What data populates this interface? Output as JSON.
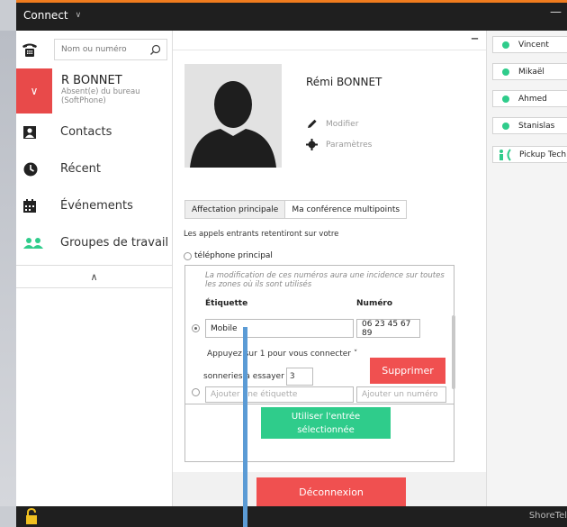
{
  "titlebar": {
    "title": "Connect"
  },
  "search": {
    "placeholder": "Nom ou numéro"
  },
  "status": {
    "name": "R BONNET",
    "sub1": "Absent(e) du bureau",
    "sub2": "(SoftPhone)"
  },
  "nav": {
    "items": [
      {
        "label": "Contacts"
      },
      {
        "label": "Récent"
      },
      {
        "label": "Événements"
      },
      {
        "label": "Groupes de travail"
      }
    ]
  },
  "profile": {
    "name": "Rémi BONNET",
    "edit_label": "Modifier",
    "settings_label": "Paramètres"
  },
  "tabs": [
    {
      "label": "Affectation principale"
    },
    {
      "label": "Ma conférence multipoints"
    }
  ],
  "assignment": {
    "calls_text": "Les appels entrants retentiront sur votre",
    "principal_label": "téléphone principal",
    "note": "La modification de ces numéros aura une incidence sur toutes les zones où ils sont utilisés",
    "col_label": "Étiquette",
    "col_number": "Numéro",
    "entry_label_value": "Mobile",
    "entry_number_value": "06 23 45 67 89",
    "appuyez_text": "Appuyez sur 1 pour vous connecter",
    "rings_label": "sonneries à essayer",
    "rings_value": "3",
    "delete_label": "Supprimer",
    "add_label_placeholder": "Ajouter une étiquette",
    "add_number_placeholder": "Ajouter un numéro",
    "use_entry_label_1": "Utiliser l'entrée",
    "use_entry_label_2": "sélectionnée"
  },
  "disconnect_label": "Déconnexion",
  "contacts": [
    {
      "name": "Vincent"
    },
    {
      "name": "Mikaël"
    },
    {
      "name": "Ahmed"
    },
    {
      "name": "Stanislas"
    }
  ],
  "pickup": {
    "label": "Pickup Tech"
  },
  "brand": {
    "label": "ShoreTel"
  },
  "colors": {
    "accent_red": "#f05050",
    "accent_green": "#2fcc8b",
    "titlebar_orange": "#f07c1e"
  },
  "icons": [
    "phone-icon",
    "search-icon",
    "chevron-down-icon",
    "contacts-icon",
    "recent-icon",
    "calendar-icon",
    "groups-icon",
    "chevron-up-icon",
    "pencil-icon",
    "gear-icon",
    "lock-icon"
  ]
}
